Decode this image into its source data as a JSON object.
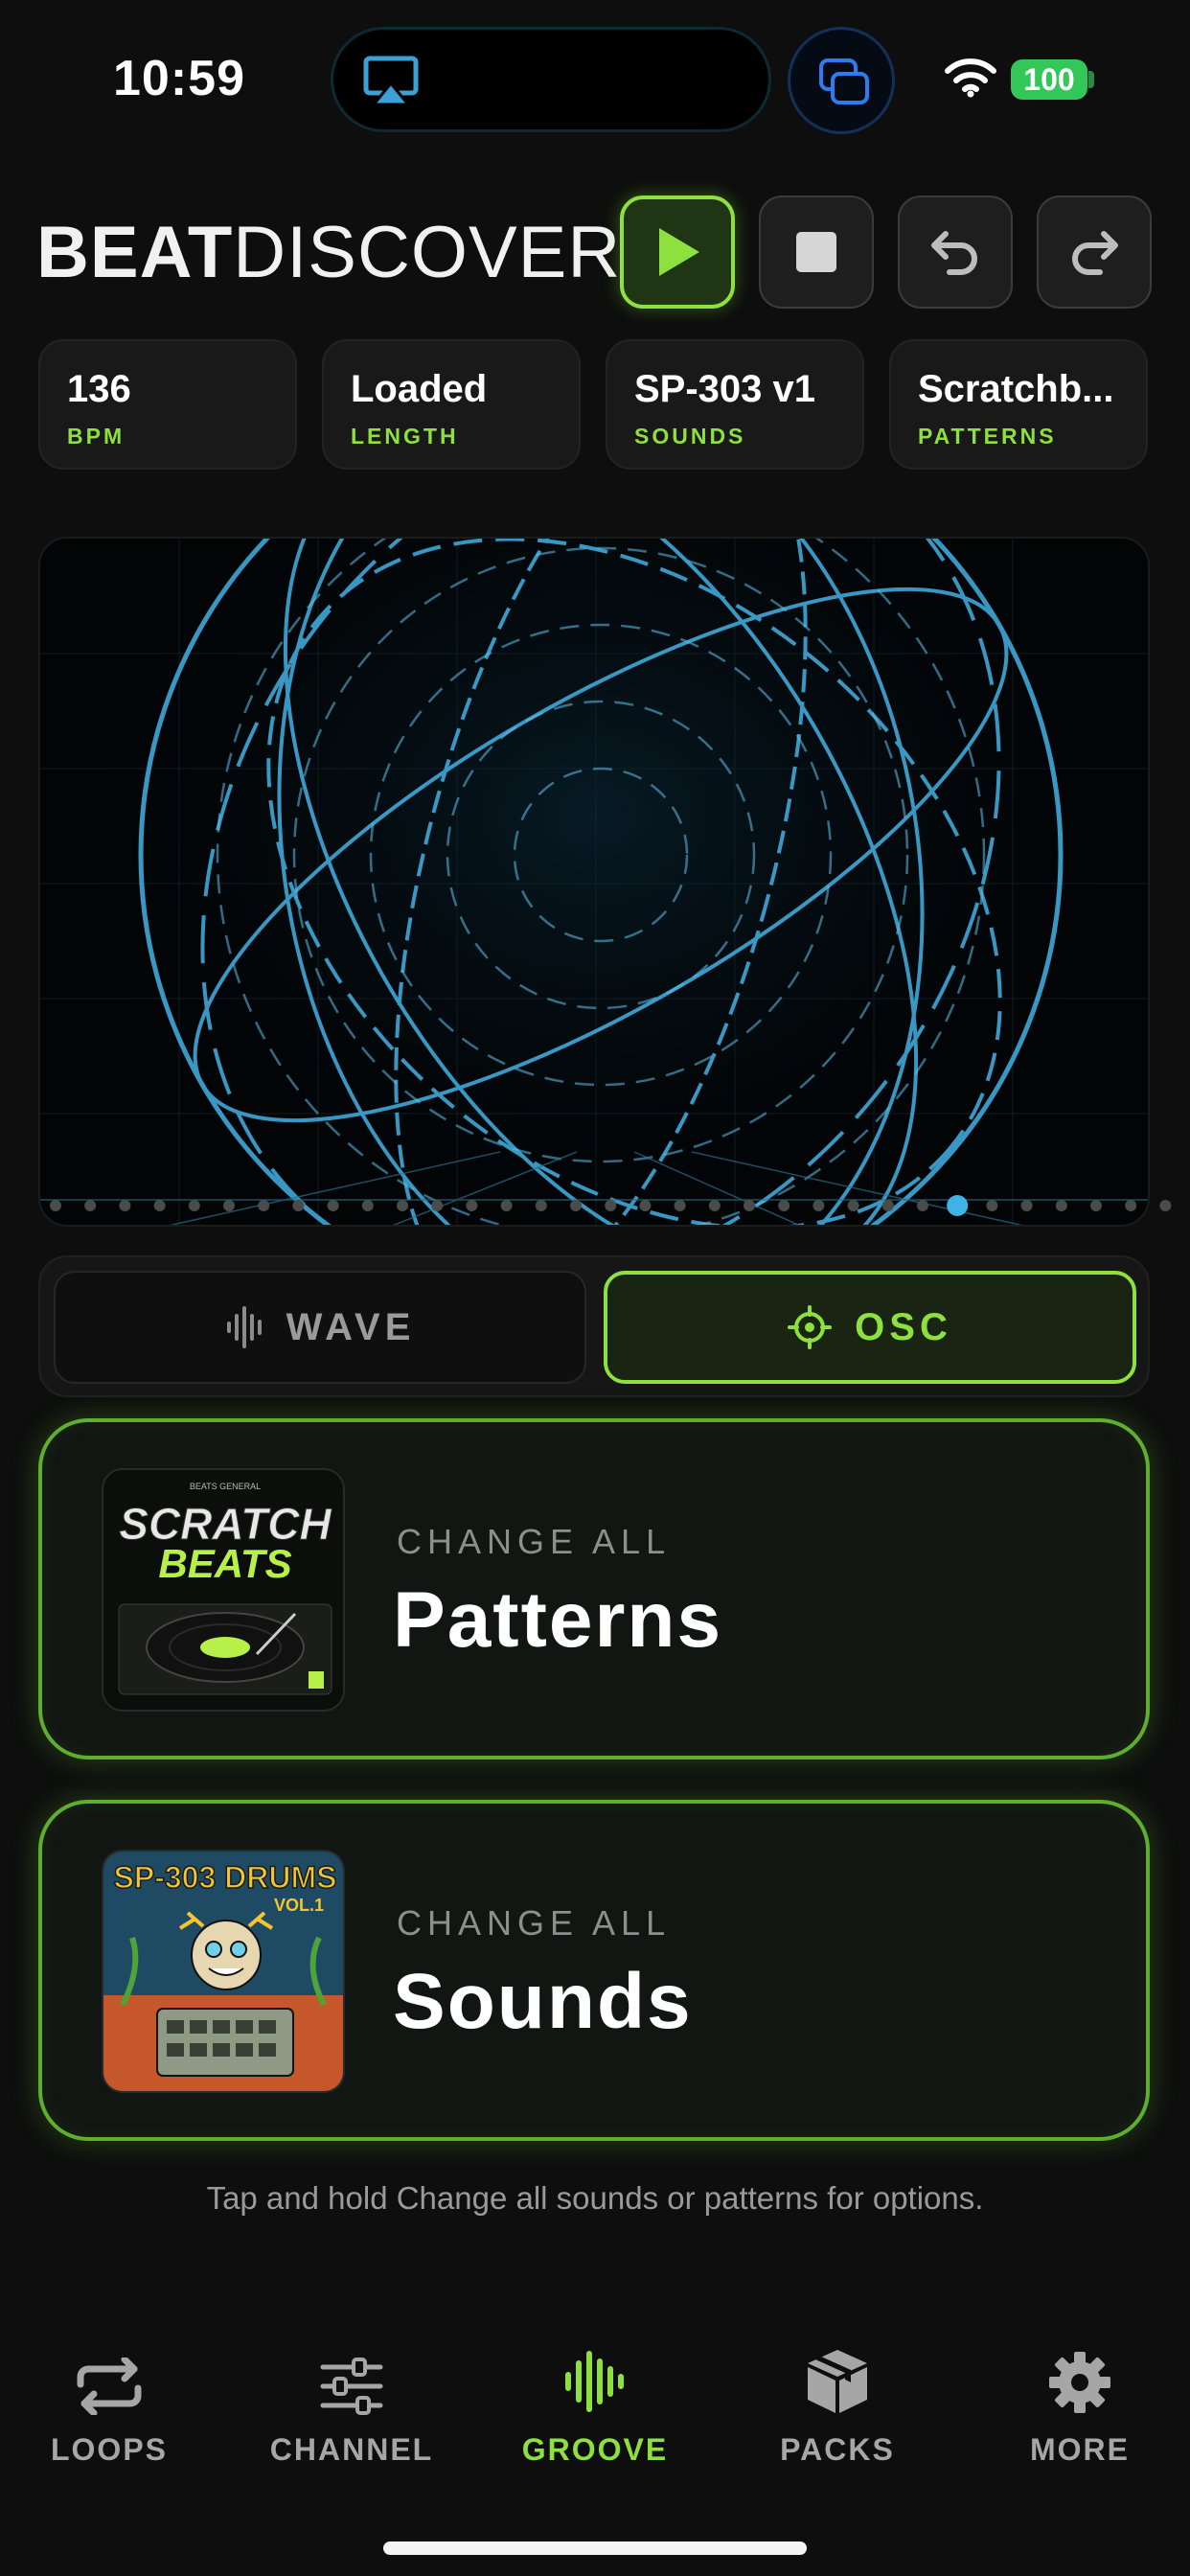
{
  "status_bar": {
    "time": "10:59",
    "battery": "100"
  },
  "app": {
    "logo_bold": "BEAT",
    "logo_light": "DISCOVERY"
  },
  "stats": [
    {
      "value": "136",
      "label": "BPM"
    },
    {
      "value": "Loaded",
      "label": "LENGTH"
    },
    {
      "value": "SP-303 v1",
      "label": "SOUNDS"
    },
    {
      "value": "Scratchb...",
      "label": "PATTERNS"
    }
  ],
  "visualizer": {
    "pages": 33,
    "active_page": 26
  },
  "modes": {
    "wave": "WAVE",
    "osc": "OSC",
    "selected": "OSC"
  },
  "change_patterns": {
    "kicker": "CHANGE ALL",
    "title": "Patterns",
    "cover_title_1": "SCRATCH",
    "cover_title_2": "BEATS",
    "cover_top": "BEATS GENERAL"
  },
  "change_sounds": {
    "kicker": "CHANGE ALL",
    "title": "Sounds",
    "cover_title": "SP-303 DRUMS",
    "cover_sub": "VOL.1"
  },
  "hint": "Tap and hold Change all sounds or patterns for options.",
  "tabs": [
    {
      "label": "LOOPS",
      "icon": "loop-icon"
    },
    {
      "label": "CHANNEL",
      "icon": "sliders-icon"
    },
    {
      "label": "GROOVE",
      "icon": "waveform-icon",
      "active": true
    },
    {
      "label": "PACKS",
      "icon": "box-icon"
    },
    {
      "label": "MORE",
      "icon": "gear-icon"
    }
  ],
  "colors": {
    "accent": "#8ee03e",
    "background": "#0d0e0d",
    "viz_line": "#3fa8d8"
  }
}
